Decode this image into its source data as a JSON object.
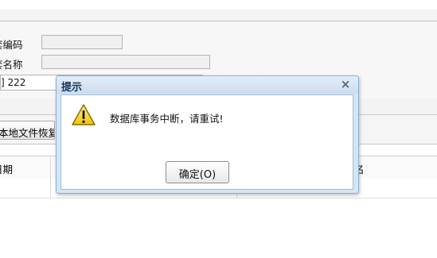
{
  "form": {
    "code_label": "套编码",
    "name_label": "套名称",
    "third_field_value": "] 222"
  },
  "toolbar": {
    "restore_button_label": "本地文件恢复"
  },
  "grid": {
    "headers": [
      "日期",
      "名"
    ]
  },
  "dialog": {
    "title": "提示",
    "close_glyph": "×",
    "message": "数据库事务中断，请重试!",
    "ok_label": "确定(O)",
    "icon": "warning-icon"
  }
}
